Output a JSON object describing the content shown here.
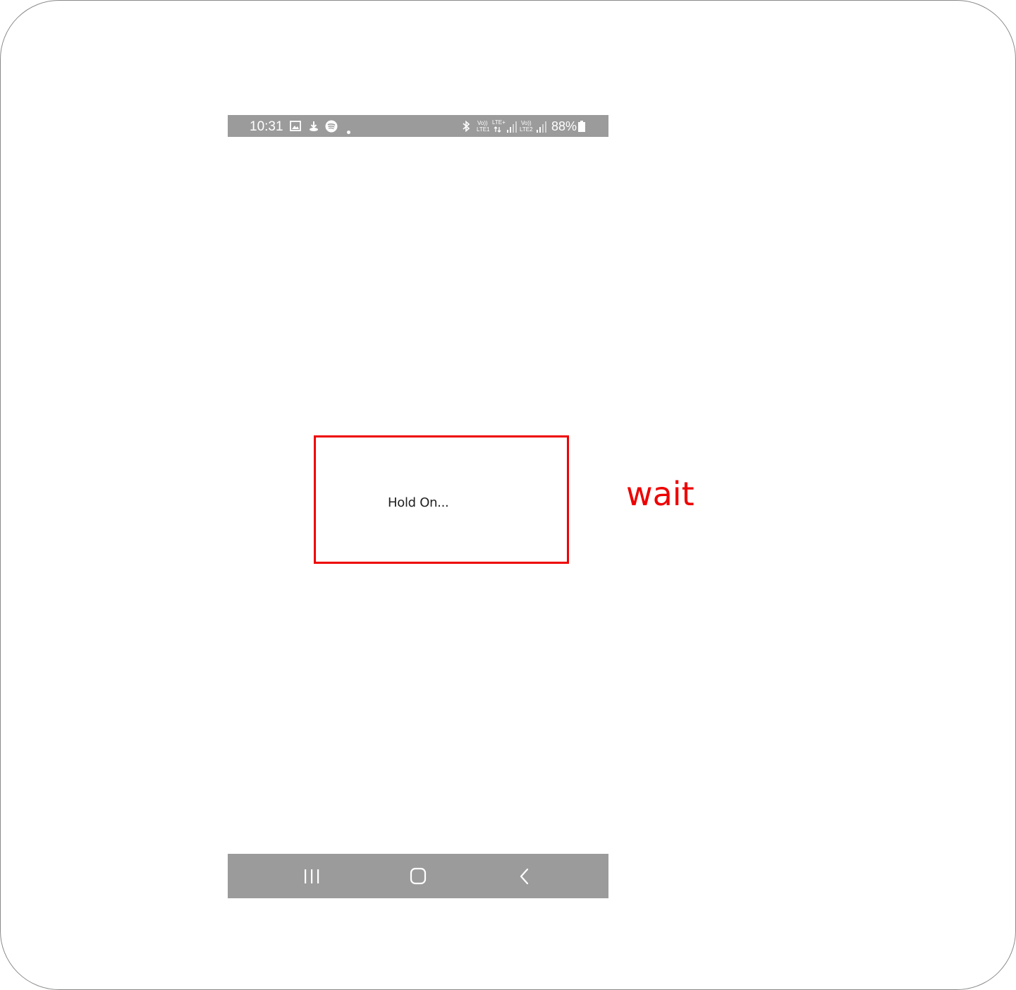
{
  "status_bar": {
    "time": "10:31",
    "left_icons": [
      "gallery-icon",
      "download-icon",
      "spotify-icon",
      "notification-dot-icon"
    ],
    "right_icons": [
      "bluetooth-icon",
      "sim1-signal-icon",
      "sim2-signal-icon",
      "battery-icon"
    ],
    "sim1_volte": "Vo))",
    "sim1_network": "LTE1",
    "sim1_type": "LTE+",
    "sim2_volte": "Vo))",
    "sim2_network": "LTE2",
    "battery_percent": "88%"
  },
  "content": {
    "loading_text": "Hold On..."
  },
  "nav_bar": {
    "buttons": [
      "recent-apps-icon",
      "home-icon",
      "back-icon"
    ]
  },
  "annotation": {
    "label": "wait",
    "color": "#ee0000"
  },
  "colors": {
    "system_bar": "#9b9b9b",
    "background": "#ffffff"
  }
}
